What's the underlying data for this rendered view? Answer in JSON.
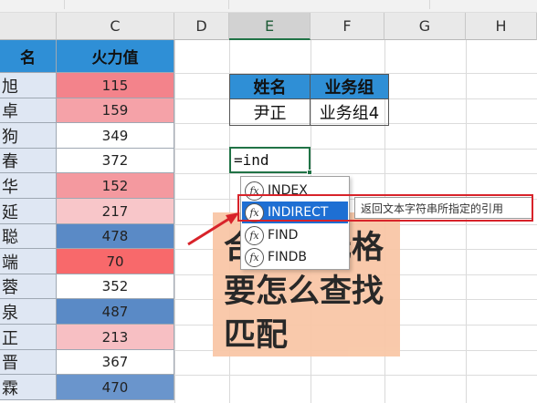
{
  "columns": [
    {
      "letter": "",
      "selected": false
    },
    {
      "letter": "C",
      "selected": false
    },
    {
      "letter": "D",
      "selected": false
    },
    {
      "letter": "E",
      "selected": true
    },
    {
      "letter": "F",
      "selected": false
    },
    {
      "letter": "G",
      "selected": false
    },
    {
      "letter": "H",
      "selected": false
    }
  ],
  "table": {
    "header_name": "名",
    "header_value": "火力值",
    "rows": [
      {
        "name": "旭",
        "value": "115",
        "color": "#f3838b"
      },
      {
        "name": "卓",
        "value": "159",
        "color": "#f5a2a8"
      },
      {
        "name": "狗",
        "value": "349",
        "color": "#ffffff"
      },
      {
        "name": "春",
        "value": "372",
        "color": "#ffffff"
      },
      {
        "name": "华",
        "value": "152",
        "color": "#f4999f"
      },
      {
        "name": "延",
        "value": "217",
        "color": "#f8c6c9"
      },
      {
        "name": "聪",
        "value": "478",
        "color": "#5a8ac6"
      },
      {
        "name": "端",
        "value": "70",
        "color": "#f8696b"
      },
      {
        "name": "蓉",
        "value": "352",
        "color": "#ffffff"
      },
      {
        "name": "泉",
        "value": "487",
        "color": "#5a8ac6"
      },
      {
        "name": "正",
        "value": "213",
        "color": "#f7bfc3"
      },
      {
        "name": "晋",
        "value": "367",
        "color": "#ffffff"
      },
      {
        "name": "霖",
        "value": "470",
        "color": "#6a95cc"
      }
    ]
  },
  "lookup": {
    "header_name": "姓名",
    "header_group": "业务组",
    "name": "尹正",
    "group": "业务组4"
  },
  "formula": "=ind",
  "autocomplete": {
    "items": [
      {
        "label": "INDEX",
        "highlighted": false
      },
      {
        "label": "INDIRECT",
        "highlighted": true
      },
      {
        "label": "FIND",
        "highlighted": false
      },
      {
        "label": "FINDB",
        "highlighted": false
      }
    ],
    "tooltip": "返回文本字符串所指定的引用",
    "fx_glyph": "fx"
  },
  "overlay": {
    "line1": "合并单元格",
    "line2": "要怎么查找",
    "line3": "匹配"
  },
  "colors": {
    "header_blue": "#2f8fd6",
    "select_green": "#217346",
    "highlight_blue": "#1e6fd3",
    "callout_red": "#d8232a"
  }
}
